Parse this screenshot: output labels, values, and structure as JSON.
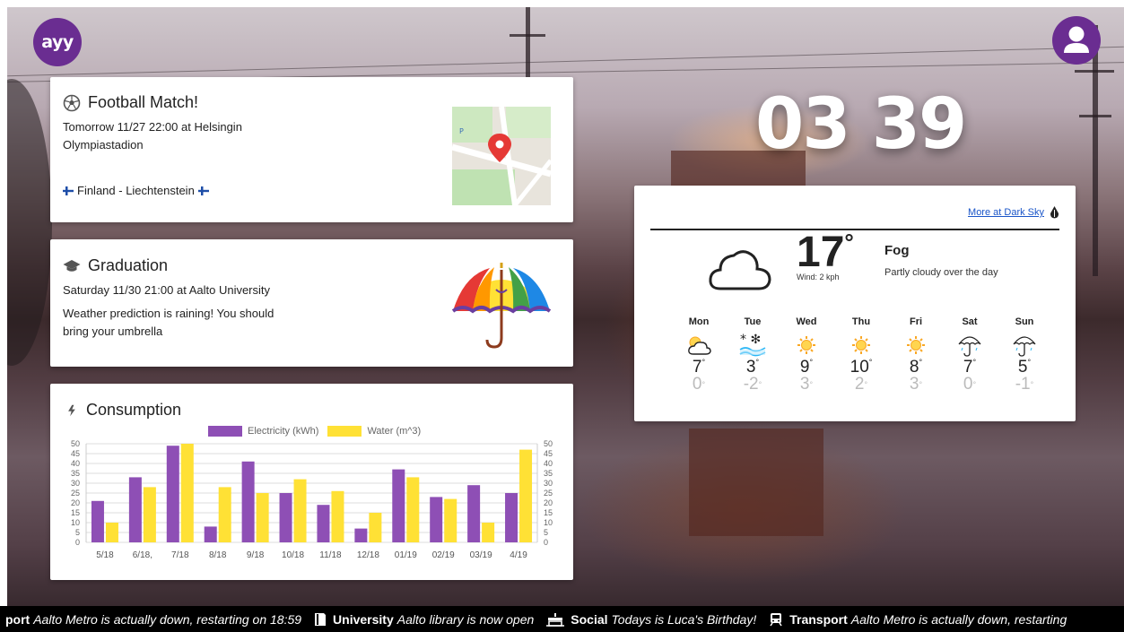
{
  "header": {
    "logo_text": "ayy",
    "avatar_icon": "user-icon",
    "clock": "03 39"
  },
  "event_card": {
    "icon": "football-icon",
    "title": "Football Match!",
    "line1": "Tomorrow 11/27 22:00 at Helsingin",
    "line2": "Olympiastadion",
    "teams": "Finland - Liechtenstein",
    "map_icon": "map-pin-icon"
  },
  "graduation_card": {
    "icon": "graduation-cap-icon",
    "title": "Graduation",
    "line1": "Saturday 11/30 21:00 at Aalto University",
    "line2": "Weather prediction is raining! You should",
    "line3": "bring your umbrella",
    "image_icon": "rainbow-umbrella-icon"
  },
  "consumption_card": {
    "icon": "lightning-icon",
    "title": "Consumption"
  },
  "chart_data": {
    "type": "bar",
    "categories": [
      "5/18",
      "6/18,",
      "7/18",
      "8/18",
      "9/18",
      "10/18",
      "11/18",
      "12/18",
      "01/19",
      "02/19",
      "03/19",
      "4/19"
    ],
    "series": [
      {
        "name": "Electricity (kWh)",
        "color": "#8e4fb5",
        "values": [
          21,
          33,
          49,
          8,
          41,
          25,
          19,
          7,
          37,
          23,
          29,
          25
        ]
      },
      {
        "name": "Water (m^3)",
        "color": "#ffe135",
        "values": [
          10,
          28,
          50,
          28,
          25,
          32,
          26,
          15,
          33,
          22,
          10,
          47
        ]
      }
    ],
    "ylim": [
      0,
      50
    ],
    "yticks": [
      "0",
      "5",
      "10",
      "15",
      "20",
      "25",
      "30",
      "35",
      "40",
      "45",
      "50"
    ],
    "legend_position": "top",
    "grid": true
  },
  "weather": {
    "link": "More at Dark Sky",
    "link_icon": "darksky-drop-icon",
    "current_icon": "cloud-icon",
    "temperature": "17",
    "degree": "°",
    "wind": "Wind: 2 kph",
    "condition": "Fog",
    "summary": "Partly cloudy over the day",
    "forecast": [
      {
        "day": "Mon",
        "icon": "partly-cloudy-icon",
        "hi": "7",
        "lo": "0"
      },
      {
        "day": "Tue",
        "icon": "snow-fog-icon",
        "hi": "3",
        "lo": "-2"
      },
      {
        "day": "Wed",
        "icon": "sun-icon",
        "hi": "9",
        "lo": "3"
      },
      {
        "day": "Thu",
        "icon": "sun-icon",
        "hi": "10",
        "lo": "2"
      },
      {
        "day": "Fri",
        "icon": "sun-icon",
        "hi": "8",
        "lo": "3"
      },
      {
        "day": "Sat",
        "icon": "umbrella-icon",
        "hi": "7",
        "lo": "0"
      },
      {
        "day": "Sun",
        "icon": "umbrella-icon",
        "hi": "5",
        "lo": "-1"
      }
    ],
    "deg_mark": "°"
  },
  "ticker": [
    {
      "icon": "",
      "category": "port",
      "text": "Aalto Metro is actually down, restarting on 18:59"
    },
    {
      "icon": "book-icon",
      "category": "University",
      "text": "Aalto library is now open"
    },
    {
      "icon": "cake-icon",
      "category": "Social",
      "text": "Todays is Luca's Birthday!"
    },
    {
      "icon": "train-icon",
      "category": "Transport",
      "text": "Aalto Metro is actually down, restarting"
    }
  ]
}
